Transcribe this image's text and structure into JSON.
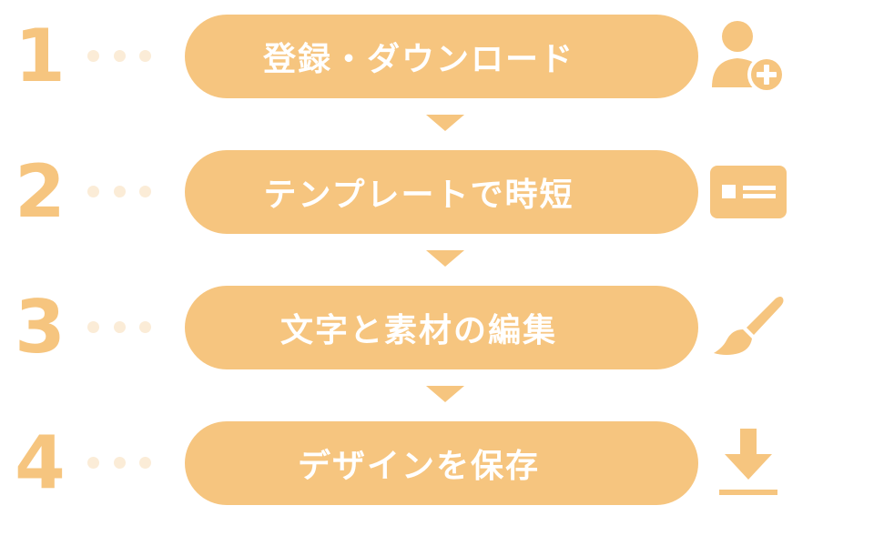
{
  "colors": {
    "accent": "#f6c57f",
    "dot": "#fbecd7",
    "label": "#ffffff"
  },
  "steps": [
    {
      "number": "1",
      "label": "登録・ダウンロード",
      "icon": "add-user-icon"
    },
    {
      "number": "2",
      "label": "テンプレートで時短",
      "icon": "template-card-icon"
    },
    {
      "number": "3",
      "label": "文字と素材の編集",
      "icon": "paintbrush-icon"
    },
    {
      "number": "4",
      "label": "デザインを保存",
      "icon": "download-icon"
    }
  ]
}
